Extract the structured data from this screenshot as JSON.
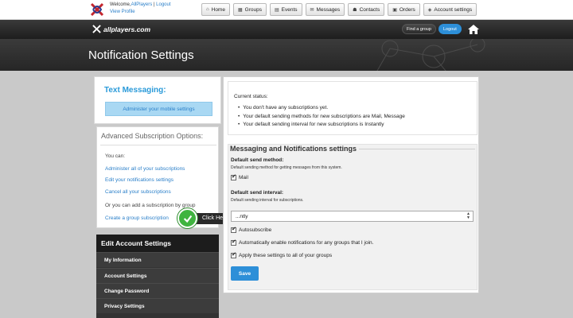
{
  "topbar": {
    "welcome_prefix": "Welcome,",
    "user_name": "AllPlayers",
    "separator": "|",
    "logout_link": "Logout",
    "view_profile": "View Profile",
    "nav": [
      {
        "label": "Home",
        "icon": "home-icon"
      },
      {
        "label": "Groups",
        "icon": "groups-icon"
      },
      {
        "label": "Events",
        "icon": "calendar-icon"
      },
      {
        "label": "Messages",
        "icon": "mail-icon"
      },
      {
        "label": "Contacts",
        "icon": "contacts-icon"
      },
      {
        "label": "Orders",
        "icon": "cart-icon"
      },
      {
        "label": "Account settings",
        "icon": "shield-icon"
      }
    ]
  },
  "header": {
    "brand": "allplayers.com",
    "find_group": "Find a group",
    "logout": "Logout",
    "home_icon": "home-icon"
  },
  "hero": {
    "title": "Notification Settings"
  },
  "sidebar": {
    "sms_title": "Text Messaging:",
    "sms_button": "Administer your mobile settings",
    "adv_title": "Advanced Subscription Options:",
    "you_can": "You can:",
    "links": [
      "Administer all of your subscriptions",
      "Edit your notifications settings",
      "Cancel all your subscriptions"
    ],
    "or_text": "Or you can add a subscription by group",
    "create_link": "Create a group subscription",
    "click_here": "Click Here",
    "edit_title": "Edit Account Settings",
    "edit_items": [
      "My Information",
      "Account Settings",
      "Change Password",
      "Privacy Settings"
    ]
  },
  "status": {
    "heading": "Current status:",
    "items": [
      "You don't have any subscriptions yet.",
      "Your default sending methods for new subscriptions are Mail, Message",
      "Your default sending interval for new subscriptions is Instantly"
    ]
  },
  "settings": {
    "title": "Messaging and Notifications settings",
    "send_method_label": "Default send method:",
    "send_method_desc": "Default sending method for getting messages from this system.",
    "mail_option": "Mail",
    "interval_label": "Default send interval:",
    "interval_desc": "Default sending interval for subscriptions.",
    "interval_value": "...ntly",
    "autosubscribe": "Autosubscribe",
    "auto_enable": "Automatically enable notifications for any groups that I join.",
    "apply_all": "Apply these settings to all of your groups",
    "save": "Save"
  },
  "colors": {
    "accent": "#2d8fd8",
    "link": "#2a7fc9",
    "dark": "#1c1c1c",
    "click_green": "#3fb43f"
  }
}
